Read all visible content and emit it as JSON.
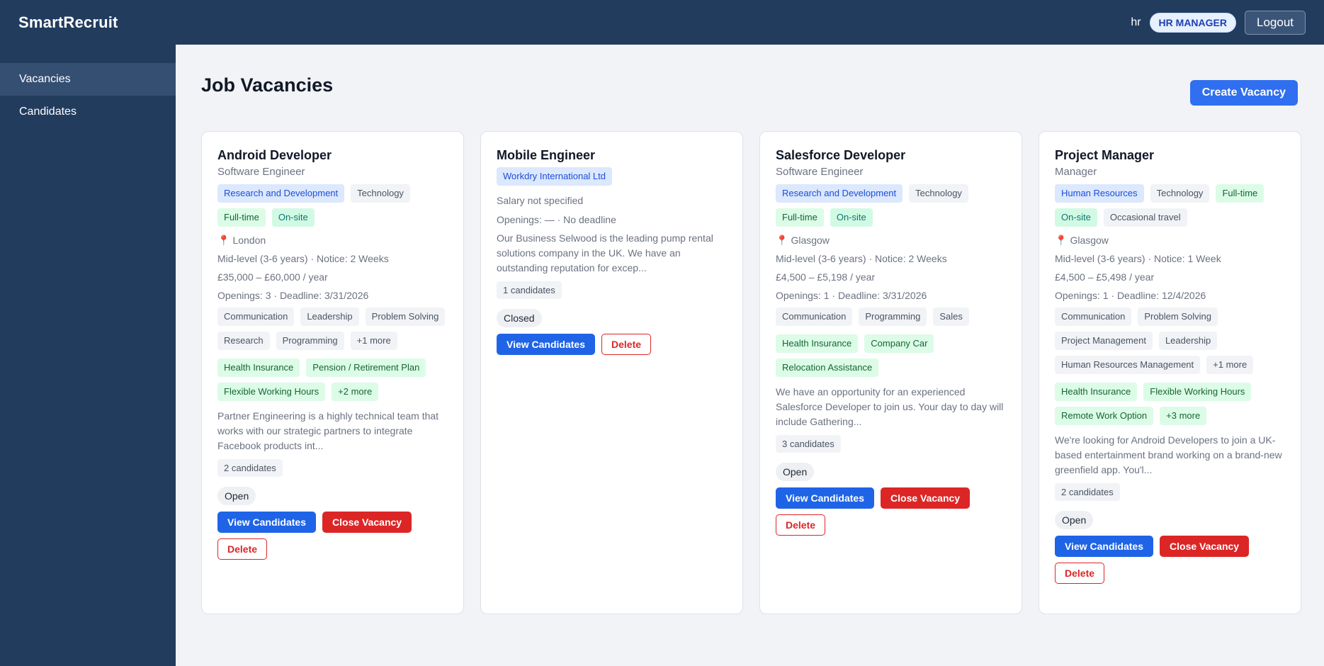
{
  "app": {
    "brand": "SmartRecruit",
    "user": "hr",
    "role": "HR MANAGER",
    "logout": "Logout"
  },
  "sidebar": {
    "items": [
      {
        "label": "Vacancies",
        "active": true
      },
      {
        "label": "Candidates",
        "active": false
      }
    ]
  },
  "page": {
    "title": "Job Vacancies",
    "create_button": "Create Vacancy"
  },
  "cards": [
    {
      "title": "Android Developer",
      "subtitle": "Software Engineer",
      "tags": [
        "Research and Development",
        "Technology"
      ],
      "employment": [
        "Full-time",
        "On-site"
      ],
      "location": "London",
      "level": "Mid-level (3-6 years) · Notice: 2 Weeks",
      "salary": "£35,000 – £60,000 / year",
      "openings": "Openings: 3 · Deadline: 3/31/2026",
      "skills": [
        "Communication",
        "Leadership",
        "Problem Solving",
        "Research",
        "Programming",
        "+1 more"
      ],
      "benefits": [
        "Health Insurance",
        "Pension / Retirement Plan",
        "Flexible Working Hours",
        "+2 more"
      ],
      "description": "Partner Engineering is a highly technical team that works with our strategic partners to integrate Facebook products int...",
      "candidates": "2 candidates",
      "status": "Open",
      "view_label": "View Candidates",
      "close_label": "Close Vacancy",
      "delete_label": "Delete"
    },
    {
      "title": "Mobile Engineer",
      "company": "Workdry International Ltd",
      "salary": "Salary not specified",
      "openings": "Openings: — · No deadline",
      "description": "Our Business Selwood is the leading pump rental solutions company in the UK. We have an outstanding reputation for excep...",
      "candidates": "1 candidates",
      "status": "Closed",
      "view_label": "View Candidates",
      "delete_label": "Delete"
    },
    {
      "title": "Salesforce Developer",
      "subtitle": "Software Engineer",
      "tags": [
        "Research and Development",
        "Technology"
      ],
      "employment": [
        "Full-time",
        "On-site"
      ],
      "location": "Glasgow",
      "level": "Mid-level (3-6 years) · Notice: 2 Weeks",
      "salary": "£4,500 – £5,198 / year",
      "openings": "Openings: 1 · Deadline: 3/31/2026",
      "skills": [
        "Communication",
        "Programming",
        "Sales"
      ],
      "benefits": [
        "Health Insurance",
        "Company Car",
        "Relocation Assistance"
      ],
      "description": "We have an opportunity for an experienced Salesforce Developer to join us. Your day to day will include Gathering...",
      "candidates": "3 candidates",
      "status": "Open",
      "view_label": "View Candidates",
      "close_label": "Close Vacancy",
      "delete_label": "Delete"
    },
    {
      "title": "Project Manager",
      "subtitle": "Manager",
      "tags": [
        "Human Resources",
        "Technology"
      ],
      "employment": [
        "Full-time",
        "On-site",
        "Occasional travel"
      ],
      "location": "Glasgow",
      "level": "Mid-level (3-6 years) · Notice: 1 Week",
      "salary": "£4,500 – £5,498 / year",
      "openings": "Openings: 1 · Deadline: 12/4/2026",
      "skills": [
        "Communication",
        "Problem Solving",
        "Project Management",
        "Leadership",
        "Human Resources Management",
        "+1 more"
      ],
      "benefits": [
        "Health Insurance",
        "Flexible Working Hours",
        "Remote Work Option",
        "+3 more"
      ],
      "description": "We're looking for Android Developers to join a UK-based entertainment brand working on a brand-new greenfield app. You'l...",
      "candidates": "2 candidates",
      "status": "Open",
      "view_label": "View Candidates",
      "close_label": "Close Vacancy",
      "delete_label": "Delete"
    }
  ],
  "icons": {
    "location": "map-pin-icon"
  },
  "colors": {
    "navbar": "#223c5e",
    "primary": "#1f64e6",
    "danger": "#dc2626",
    "tag_blue": "#dbe8fd",
    "tag_green": "#dcfce7"
  }
}
